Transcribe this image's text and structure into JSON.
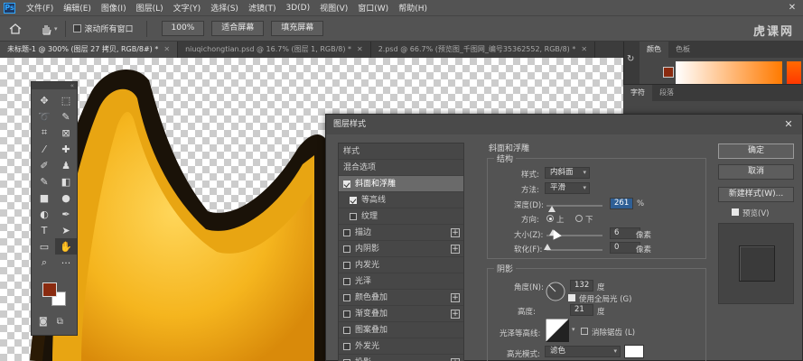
{
  "app": {
    "logo_text": "Ps",
    "watermark": "虎课网"
  },
  "menubar": {
    "items": [
      "文件(F)",
      "编辑(E)",
      "图像(I)",
      "图层(L)",
      "文字(Y)",
      "选择(S)",
      "滤镜(T)",
      "3D(D)",
      "视图(V)",
      "窗口(W)",
      "帮助(H)"
    ]
  },
  "options_bar": {
    "scroll_all_label": "滚动所有窗口",
    "zoom_value": "100%",
    "fit_screen_label": "适合屏幕",
    "fill_screen_label": "填充屏幕"
  },
  "tabs": [
    {
      "label": "未标题-1 @ 300% (图层 27 拷贝, RGB/8#) *",
      "active": true
    },
    {
      "label": "niuqichongtian.psd @ 16.7% (图层 1, RGB/8) *",
      "active": false
    },
    {
      "label": "2.psd @ 66.7% (预览图_千图网_编号35362552, RGB/8) *",
      "active": false
    }
  ],
  "right_panels": {
    "color_tabs": [
      "颜色",
      "色板"
    ],
    "char_tabs": [
      "字符",
      "段落"
    ]
  },
  "dialog": {
    "title": "图层样式",
    "style_list": [
      {
        "label": "样式",
        "checkbox": false,
        "checked": false,
        "plus": false,
        "indent": false,
        "selected": false
      },
      {
        "label": "混合选项",
        "checkbox": false,
        "checked": false,
        "plus": false,
        "indent": false,
        "selected": false
      },
      {
        "label": "斜面和浮雕",
        "checkbox": true,
        "checked": true,
        "plus": false,
        "indent": false,
        "selected": true
      },
      {
        "label": "等高线",
        "checkbox": true,
        "checked": true,
        "plus": false,
        "indent": true,
        "selected": false
      },
      {
        "label": "纹理",
        "checkbox": true,
        "checked": false,
        "plus": false,
        "indent": true,
        "selected": false
      },
      {
        "label": "描边",
        "checkbox": true,
        "checked": false,
        "plus": true,
        "indent": false,
        "selected": false
      },
      {
        "label": "内阴影",
        "checkbox": true,
        "checked": false,
        "plus": true,
        "indent": false,
        "selected": false
      },
      {
        "label": "内发光",
        "checkbox": true,
        "checked": false,
        "plus": false,
        "indent": false,
        "selected": false
      },
      {
        "label": "光泽",
        "checkbox": true,
        "checked": false,
        "plus": false,
        "indent": false,
        "selected": false
      },
      {
        "label": "颜色叠加",
        "checkbox": true,
        "checked": false,
        "plus": true,
        "indent": false,
        "selected": false
      },
      {
        "label": "渐变叠加",
        "checkbox": true,
        "checked": false,
        "plus": true,
        "indent": false,
        "selected": false
      },
      {
        "label": "图案叠加",
        "checkbox": true,
        "checked": false,
        "plus": false,
        "indent": false,
        "selected": false
      },
      {
        "label": "外发光",
        "checkbox": true,
        "checked": false,
        "plus": false,
        "indent": false,
        "selected": false
      },
      {
        "label": "投影",
        "checkbox": true,
        "checked": false,
        "plus": true,
        "indent": false,
        "selected": false
      }
    ],
    "section_title": "斜面和浮雕",
    "structure": {
      "title": "结构",
      "style_label": "样式:",
      "style_value": "内斜面",
      "technique_label": "方法:",
      "technique_value": "平滑",
      "depth_label": "深度(D):",
      "depth_value": "261",
      "depth_unit": "%",
      "direction_label": "方向:",
      "direction_up": "上",
      "direction_down": "下",
      "size_label": "大小(Z):",
      "size_value": "6",
      "size_unit": "像素",
      "soften_label": "软化(F):",
      "soften_value": "0",
      "soften_unit": "像素"
    },
    "shading": {
      "title": "阴影",
      "angle_label": "角度(N):",
      "angle_value": "132",
      "angle_unit": "度",
      "global_light_label": "使用全局光 (G)",
      "altitude_label": "高度:",
      "altitude_value": "21",
      "altitude_unit": "度",
      "gloss_contour_label": "光泽等高线:",
      "anti_aliased_label": "消除锯齿 (L)",
      "highlight_mode_label": "高光模式:",
      "highlight_mode_value": "滤色"
    },
    "buttons": {
      "ok": "确定",
      "cancel": "取消",
      "new_style": "新建样式(W)...",
      "preview": "预览(V)"
    }
  }
}
